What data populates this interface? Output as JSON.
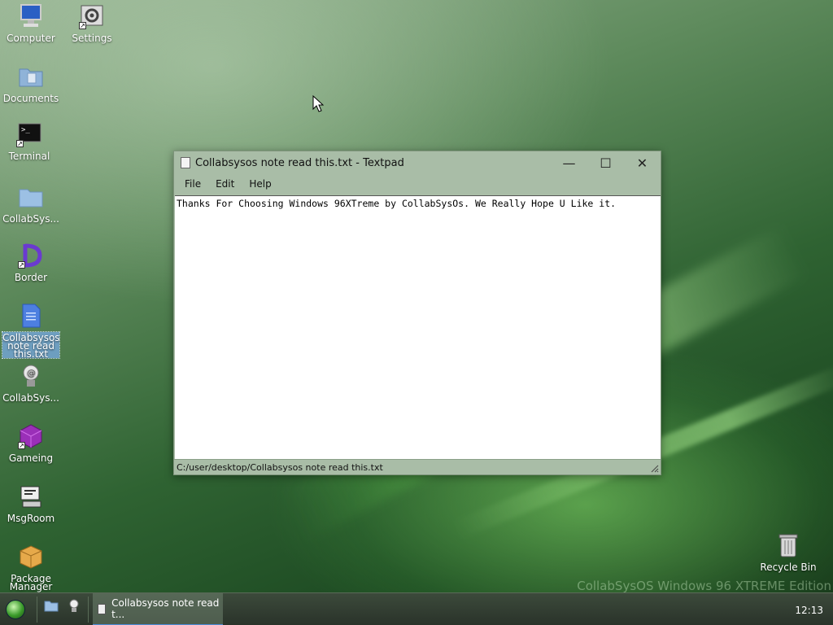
{
  "desktop": {
    "icons": [
      {
        "label": "Computer"
      },
      {
        "label": "Settings"
      },
      {
        "label": "Documents"
      },
      {
        "label": "Terminal"
      },
      {
        "label": "CollabSys..."
      },
      {
        "label": "Border"
      },
      {
        "label": "Collabsysos note read this.txt"
      },
      {
        "label": "CollabSys..."
      },
      {
        "label": "Gameing"
      },
      {
        "label": "MsgRoom"
      },
      {
        "label": "Package Manager"
      },
      {
        "label": "Recycle Bin"
      }
    ],
    "watermark": "CollabSysOS Windows 96 XTREME Edition"
  },
  "window": {
    "title": "Collabsysos note read this.txt - Textpad",
    "menu": [
      "File",
      "Edit",
      "Help"
    ],
    "content": "Thanks For Choosing Windows 96XTreme by CollabSysOs. We Really Hope U Like it.",
    "status_path": "C:/user/desktop/Collabsysos note read this.txt"
  },
  "taskbar": {
    "task_label": "Collabsysos note read t...",
    "clock": "12:13"
  },
  "colors": {
    "accent": "#4b8bd8",
    "window_chrome": "#a9bda7",
    "taskbar": "#333d33"
  }
}
